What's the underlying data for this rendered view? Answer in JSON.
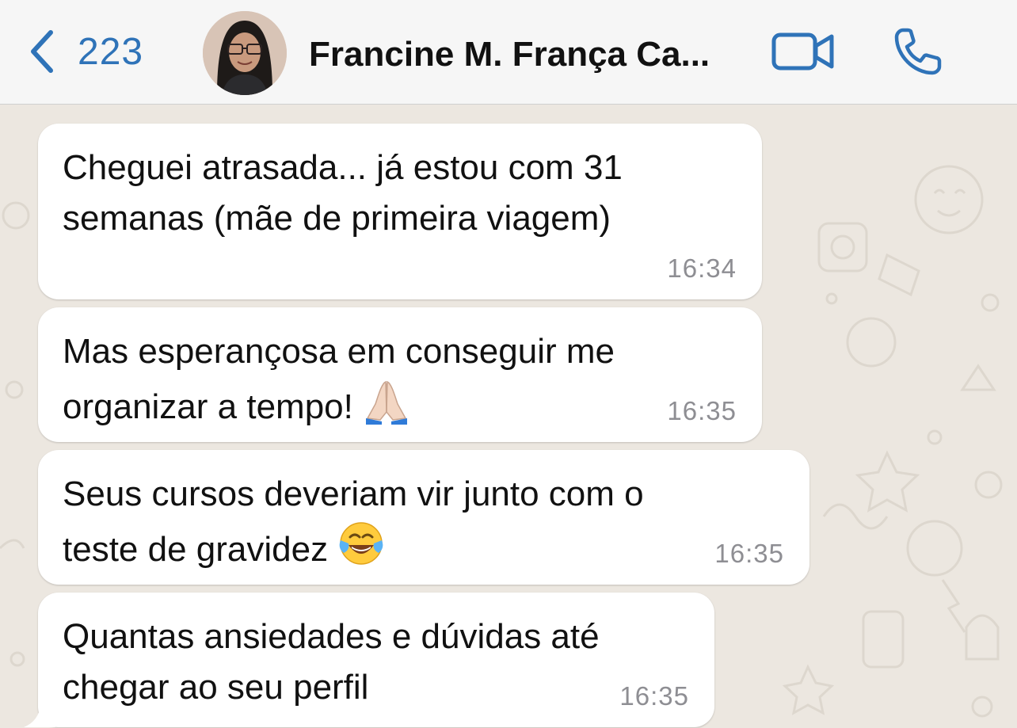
{
  "header": {
    "back_count": "223",
    "contact_name": "Francine M. França Ca...",
    "accent_color": "#2F73B8",
    "icons": [
      "chevron-left-icon",
      "video-camera-icon",
      "phone-icon"
    ]
  },
  "messages": [
    {
      "text": "Cheguei atrasada... já estou com 31\nsemanas (mãe de primeira viagem)",
      "time": "16:34"
    },
    {
      "text": "Mas esperançosa em conseguir me\norganizar a tempo!",
      "emoji": "folded-hands-emoji",
      "time": "16:35"
    },
    {
      "text": "Seus cursos deveriam vir junto com o\nteste de gravidez",
      "emoji": "face-with-tears-of-joy-emoji",
      "time": "16:35"
    },
    {
      "text": "Quantas ansiedades e dúvidas até\nchegar ao seu perfil",
      "time": "16:35"
    }
  ],
  "colors": {
    "header_bg": "#F6F6F6",
    "chat_bg": "#ECE7E0",
    "bubble_bg": "#FFFFFF",
    "timestamp": "#8E8E93"
  }
}
